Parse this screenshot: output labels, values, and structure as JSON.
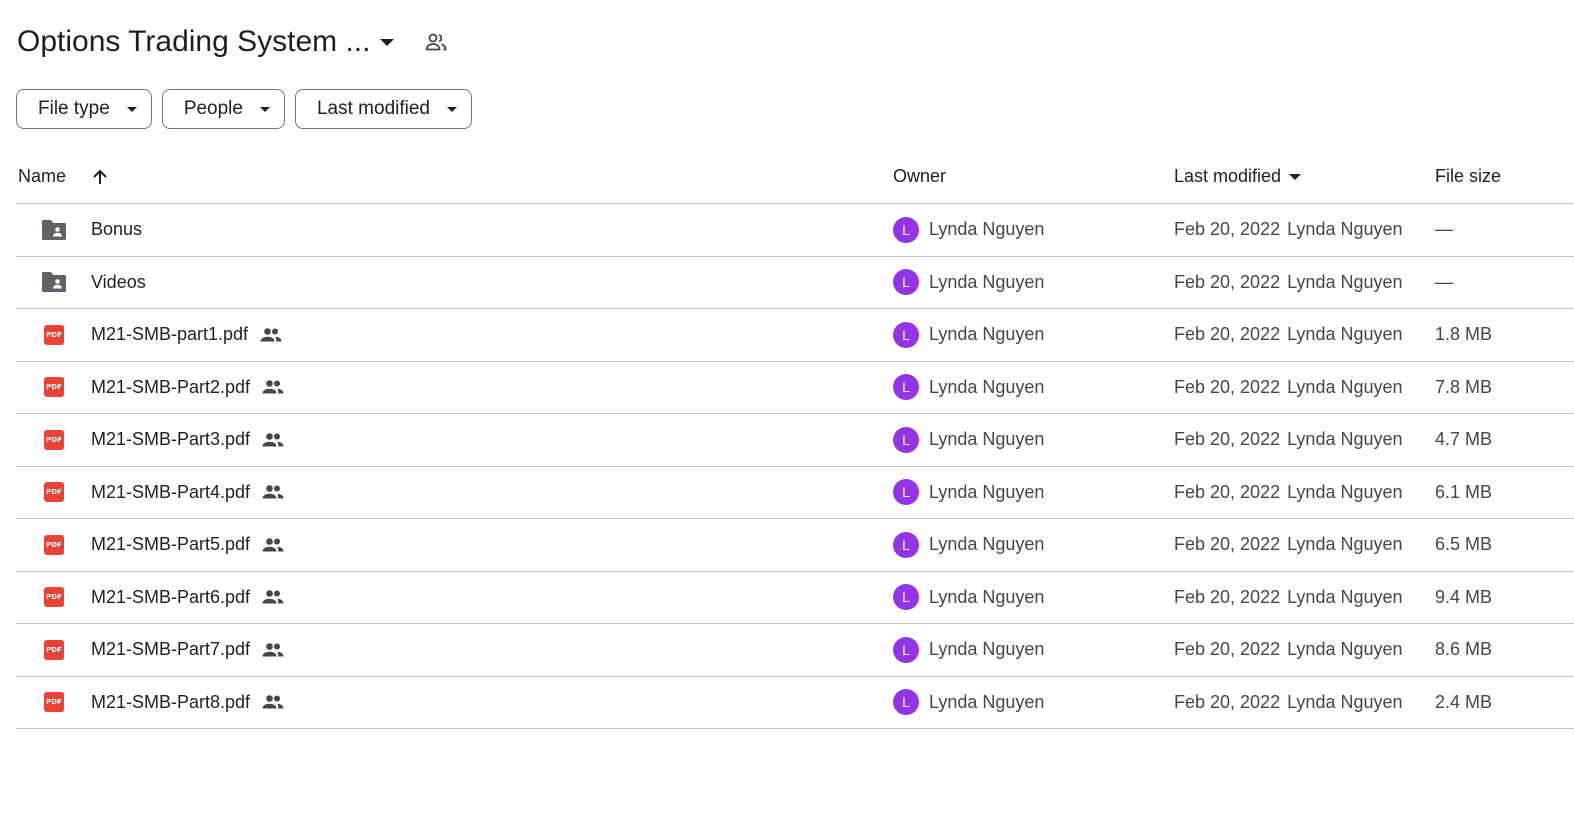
{
  "header": {
    "folder_title": "Options Trading System ...",
    "shared_icon": "people-outline-icon"
  },
  "filters": [
    {
      "label": "File type"
    },
    {
      "label": "People"
    },
    {
      "label": "Last modified"
    }
  ],
  "columns": {
    "name": "Name",
    "owner": "Owner",
    "last_modified": "Last modified",
    "file_size": "File size"
  },
  "sort": {
    "column": "name",
    "direction": "ascending"
  },
  "colors": {
    "avatar": "#9334e6",
    "pdf": "#ea4335",
    "folder": "#5f6368"
  },
  "files": [
    {
      "type": "shared-folder",
      "name": "Bonus",
      "shared": false,
      "owner_initial": "L",
      "owner": "Lynda Nguyen",
      "modified_date": "Feb 20, 2022",
      "modified_by": "Lynda Nguyen",
      "size": "—"
    },
    {
      "type": "shared-folder",
      "name": "Videos",
      "shared": false,
      "owner_initial": "L",
      "owner": "Lynda Nguyen",
      "modified_date": "Feb 20, 2022",
      "modified_by": "Lynda Nguyen",
      "size": "—"
    },
    {
      "type": "pdf",
      "name": "M21-SMB-part1.pdf",
      "shared": true,
      "owner_initial": "L",
      "owner": "Lynda Nguyen",
      "modified_date": "Feb 20, 2022",
      "modified_by": "Lynda Nguyen",
      "size": "1.8 MB"
    },
    {
      "type": "pdf",
      "name": "M21-SMB-Part2.pdf",
      "shared": true,
      "owner_initial": "L",
      "owner": "Lynda Nguyen",
      "modified_date": "Feb 20, 2022",
      "modified_by": "Lynda Nguyen",
      "size": "7.8 MB"
    },
    {
      "type": "pdf",
      "name": "M21-SMB-Part3.pdf",
      "shared": true,
      "owner_initial": "L",
      "owner": "Lynda Nguyen",
      "modified_date": "Feb 20, 2022",
      "modified_by": "Lynda Nguyen",
      "size": "4.7 MB"
    },
    {
      "type": "pdf",
      "name": "M21-SMB-Part4.pdf",
      "shared": true,
      "owner_initial": "L",
      "owner": "Lynda Nguyen",
      "modified_date": "Feb 20, 2022",
      "modified_by": "Lynda Nguyen",
      "size": "6.1 MB"
    },
    {
      "type": "pdf",
      "name": "M21-SMB-Part5.pdf",
      "shared": true,
      "owner_initial": "L",
      "owner": "Lynda Nguyen",
      "modified_date": "Feb 20, 2022",
      "modified_by": "Lynda Nguyen",
      "size": "6.5 MB"
    },
    {
      "type": "pdf",
      "name": "M21-SMB-Part6.pdf",
      "shared": true,
      "owner_initial": "L",
      "owner": "Lynda Nguyen",
      "modified_date": "Feb 20, 2022",
      "modified_by": "Lynda Nguyen",
      "size": "9.4 MB"
    },
    {
      "type": "pdf",
      "name": "M21-SMB-Part7.pdf",
      "shared": true,
      "owner_initial": "L",
      "owner": "Lynda Nguyen",
      "modified_date": "Feb 20, 2022",
      "modified_by": "Lynda Nguyen",
      "size": "8.6 MB"
    },
    {
      "type": "pdf",
      "name": "M21-SMB-Part8.pdf",
      "shared": true,
      "owner_initial": "L",
      "owner": "Lynda Nguyen",
      "modified_date": "Feb 20, 2022",
      "modified_by": "Lynda Nguyen",
      "size": "2.4 MB"
    }
  ],
  "pdf_icon_text": "PDF"
}
